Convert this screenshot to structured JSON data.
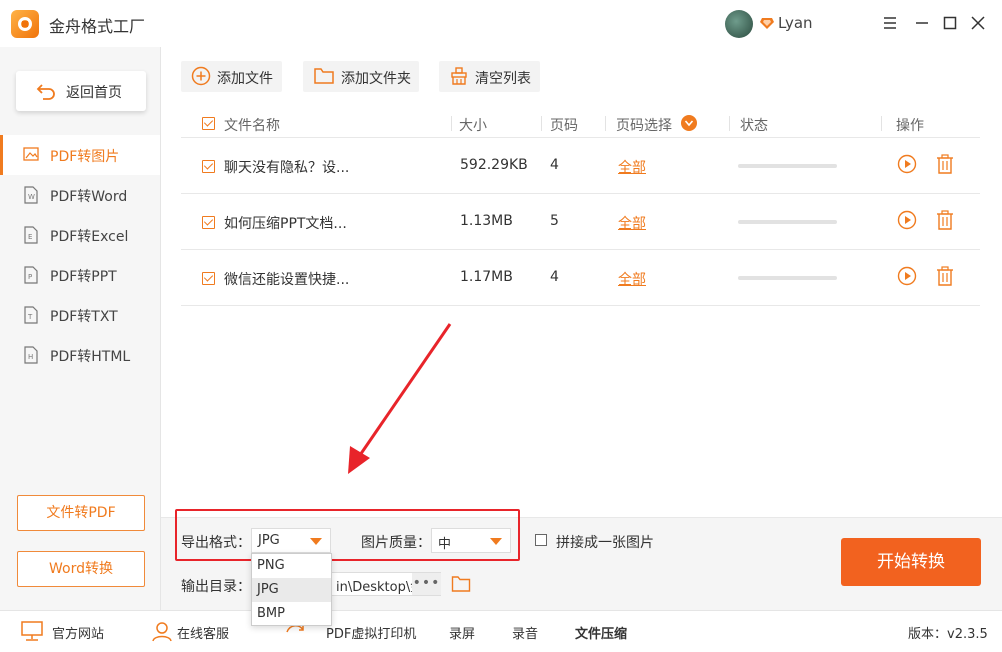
{
  "app": {
    "title": "金舟格式工厂",
    "username": "Lyan"
  },
  "sidebar": {
    "home_label": "返回首页",
    "items": [
      {
        "label": "PDF转图片",
        "active": true
      },
      {
        "label": "PDF转Word"
      },
      {
        "label": "PDF转Excel"
      },
      {
        "label": "PDF转PPT"
      },
      {
        "label": "PDF转TXT"
      },
      {
        "label": "PDF转HTML"
      }
    ],
    "bottom_buttons": [
      "文件转PDF",
      "Word转换"
    ]
  },
  "toolbar": {
    "add_file": "添加文件",
    "add_folder": "添加文件夹",
    "clear_list": "清空列表"
  },
  "table": {
    "headers": {
      "name": "文件名称",
      "size": "大小",
      "pages": "页码",
      "page_select": "页码选择",
      "status": "状态",
      "action": "操作"
    },
    "rows": [
      {
        "name": "聊天没有隐私？设...",
        "size": "592.29KB",
        "pages": "4",
        "page_select": "全部",
        "progress": 0
      },
      {
        "name": "如何压缩PPT文档...",
        "size": "1.13MB",
        "pages": "5",
        "page_select": "全部",
        "progress": 0
      },
      {
        "name": "微信还能设置快捷...",
        "size": "1.17MB",
        "pages": "4",
        "page_select": "全部",
        "progress": 0
      }
    ]
  },
  "settings": {
    "format_label": "导出格式：",
    "format_value": "JPG",
    "format_options": [
      "PNG",
      "JPG",
      "BMP"
    ],
    "quality_label": "图片质量：",
    "quality_value": "中",
    "stitch_label": "拼接成一张图片",
    "output_label": "输出目录：",
    "output_value": "in\\Desktop\\金",
    "output_more": "•••",
    "start_label": "开始转换"
  },
  "statusbar": {
    "website": "官方网站",
    "service": "在线客服",
    "printer": "PDF虚拟打印机",
    "screen_record": "录屏",
    "audio_record": "录音",
    "compress": "文件压缩",
    "version": "版本：v2.3.5"
  },
  "colors": {
    "accent": "#f07b1f",
    "start_button": "#f2621f",
    "annotation": "#e8242a"
  }
}
